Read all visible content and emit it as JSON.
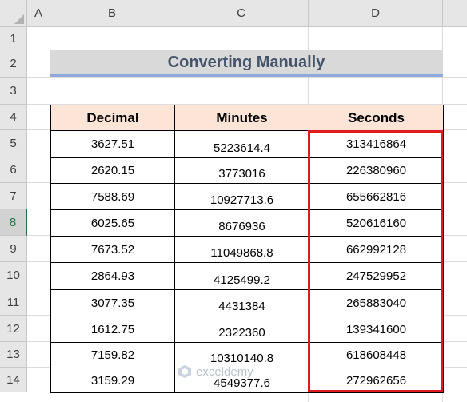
{
  "columns": [
    "A",
    "B",
    "C",
    "D"
  ],
  "rows": [
    "1",
    "2",
    "3",
    "4",
    "5",
    "6",
    "7",
    "8",
    "9",
    "10",
    "11",
    "12",
    "13",
    "14"
  ],
  "active_row": "8",
  "title": "Converting Manually",
  "table": {
    "headers": [
      "Decimal",
      "Minutes",
      "Seconds"
    ],
    "rows": [
      [
        "3627.51",
        "5223614.4",
        "313416864"
      ],
      [
        "2620.15",
        "3773016",
        "226380960"
      ],
      [
        "7588.69",
        "10927713.6",
        "655662816"
      ],
      [
        "6025.65",
        "8676936",
        "520616160"
      ],
      [
        "7673.52",
        "11049868.8",
        "662992128"
      ],
      [
        "2864.93",
        "4125499.2",
        "247529952"
      ],
      [
        "3077.35",
        "4431384",
        "265883040"
      ],
      [
        "1612.75",
        "2322360",
        "139341600"
      ],
      [
        "7159.82",
        "10310140.8",
        "618608448"
      ],
      [
        "3159.29",
        "4549377.6",
        "272962656"
      ]
    ]
  },
  "watermark": "exceldemy",
  "colors": {
    "header_fill": "#fce4d6",
    "title_fill": "#d9d9d9",
    "title_text": "#44546a",
    "highlight": "#e01b1b",
    "active_row": "#217346"
  }
}
